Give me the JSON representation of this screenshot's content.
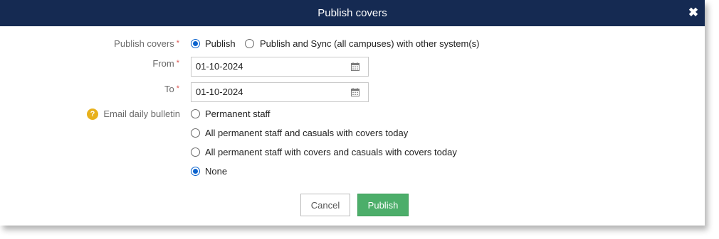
{
  "dialog": {
    "title": "Publish covers",
    "close_icon": "close-icon"
  },
  "form": {
    "publish_covers": {
      "label": "Publish covers",
      "required_mark": "*",
      "options": [
        "Publish",
        "Publish and Sync (all campuses) with other system(s)"
      ],
      "selected": "Publish"
    },
    "from": {
      "label": "From",
      "required_mark": "*",
      "value": "01-10-2024"
    },
    "to": {
      "label": "To",
      "required_mark": "*",
      "value": "01-10-2024"
    },
    "email_bulletin": {
      "label": "Email daily bulletin",
      "options": [
        "Permanent staff",
        "All permanent staff and casuals with covers today",
        "All permanent staff with covers and casuals with covers today",
        "None"
      ],
      "selected": "None"
    }
  },
  "buttons": {
    "cancel": "Cancel",
    "publish": "Publish"
  },
  "colors": {
    "titlebar": "#152a52",
    "accent": "#0b63ce",
    "publish_button": "#4cae6a",
    "required": "#d9534f",
    "help": "#e8b11c"
  }
}
